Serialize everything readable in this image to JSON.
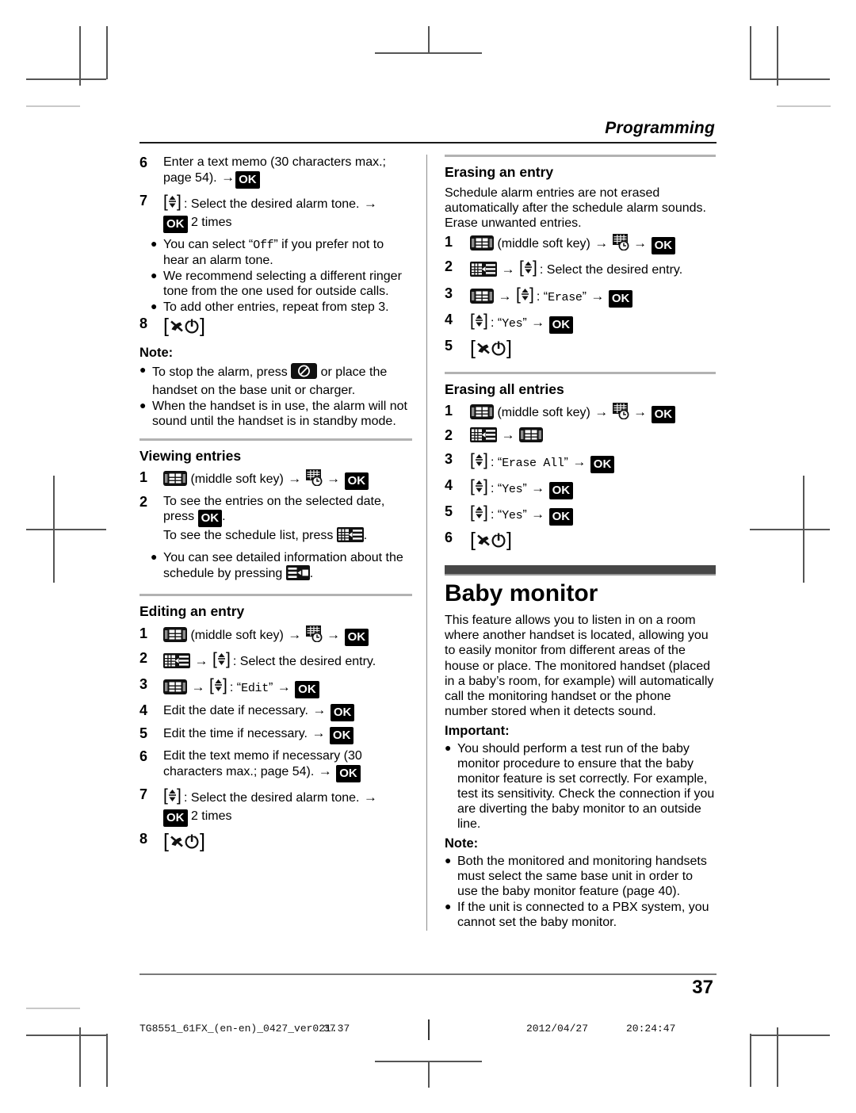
{
  "header": {
    "running_head": "Programming"
  },
  "left_column": {
    "alarm_steps": [
      {
        "n": "6",
        "segments": [
          {
            "t": "text",
            "v": "Enter a text memo (30 characters max.; page 54). "
          },
          {
            "t": "arrow"
          },
          {
            "t": "ok",
            "v": "OK"
          }
        ]
      },
      {
        "n": "7",
        "segments": [
          {
            "t": "navkey"
          },
          {
            "t": "text",
            "v": ": Select the desired alarm tone. "
          },
          {
            "t": "arrow"
          },
          {
            "t": "br"
          },
          {
            "t": "ok",
            "v": "OK"
          },
          {
            "t": "text",
            "v": " 2 times"
          }
        ]
      }
    ],
    "alarm_bullets": [
      {
        "segments": [
          {
            "t": "text",
            "v": "You can select “"
          },
          {
            "t": "mono",
            "v": "Off"
          },
          {
            "t": "text",
            "v": "” if you prefer not to hear an alarm tone."
          }
        ]
      },
      {
        "segments": [
          {
            "t": "text",
            "v": "We recommend selecting a different ringer tone from the one used for outside calls."
          }
        ]
      },
      {
        "segments": [
          {
            "t": "text",
            "v": "To add other entries, repeat from step 3."
          }
        ]
      }
    ],
    "alarm_final_step": {
      "n": "8",
      "segments": [
        {
          "t": "hangup"
        }
      ]
    },
    "note_label": "Note:",
    "note_bullets": [
      {
        "segments": [
          {
            "t": "text",
            "v": "To stop the alarm, press "
          },
          {
            "t": "icon",
            "v": "off-key-icon"
          },
          {
            "t": "text",
            "v": " or place the handset on the base unit or charger."
          }
        ]
      },
      {
        "segments": [
          {
            "t": "text",
            "v": "When the handset is in use, the alarm will not sound until the handset is in standby mode."
          }
        ]
      }
    ],
    "viewing": {
      "title": "Viewing entries",
      "steps": [
        {
          "n": "1",
          "segments": [
            {
              "t": "icon",
              "v": "soft-key-icon"
            },
            {
              "t": "text",
              "v": " (middle soft key) "
            },
            {
              "t": "arrow"
            },
            {
              "t": "text",
              "v": " "
            },
            {
              "t": "icon",
              "v": "schedule-clock-icon"
            },
            {
              "t": "text",
              "v": " "
            },
            {
              "t": "arrow"
            },
            {
              "t": "text",
              "v": " "
            },
            {
              "t": "ok",
              "v": "OK"
            }
          ]
        },
        {
          "n": "2",
          "segments": [
            {
              "t": "text",
              "v": "To see the entries on the selected date, press "
            },
            {
              "t": "ok",
              "v": "OK"
            },
            {
              "t": "text",
              "v": "."
            },
            {
              "t": "br"
            },
            {
              "t": "text",
              "v": "To see the schedule list, press "
            },
            {
              "t": "icon",
              "v": "schedule-list-icon"
            },
            {
              "t": "text",
              "v": "."
            }
          ]
        }
      ],
      "bullets": [
        {
          "segments": [
            {
              "t": "text",
              "v": "You can see detailed information about the schedule by pressing "
            },
            {
              "t": "icon",
              "v": "detail-icon"
            },
            {
              "t": "text",
              "v": "."
            }
          ]
        }
      ]
    },
    "editing": {
      "title": "Editing an entry",
      "steps": [
        {
          "n": "1",
          "segments": [
            {
              "t": "icon",
              "v": "soft-key-icon"
            },
            {
              "t": "text",
              "v": " (middle soft key) "
            },
            {
              "t": "arrow"
            },
            {
              "t": "text",
              "v": " "
            },
            {
              "t": "icon",
              "v": "schedule-clock-icon"
            },
            {
              "t": "text",
              "v": " "
            },
            {
              "t": "arrow"
            },
            {
              "t": "text",
              "v": " "
            },
            {
              "t": "ok",
              "v": "OK"
            }
          ]
        },
        {
          "n": "2",
          "segments": [
            {
              "t": "icon",
              "v": "schedule-list-icon"
            },
            {
              "t": "text",
              "v": " "
            },
            {
              "t": "arrow"
            },
            {
              "t": "text",
              "v": " "
            },
            {
              "t": "navkey"
            },
            {
              "t": "text",
              "v": ": Select the desired entry."
            }
          ]
        },
        {
          "n": "3",
          "segments": [
            {
              "t": "icon",
              "v": "soft-key-icon"
            },
            {
              "t": "text",
              "v": " "
            },
            {
              "t": "arrow"
            },
            {
              "t": "text",
              "v": " "
            },
            {
              "t": "navkey"
            },
            {
              "t": "text",
              "v": ": “"
            },
            {
              "t": "mono",
              "v": "Edit"
            },
            {
              "t": "text",
              "v": "” "
            },
            {
              "t": "arrow"
            },
            {
              "t": "text",
              "v": " "
            },
            {
              "t": "ok",
              "v": "OK"
            }
          ]
        },
        {
          "n": "4",
          "segments": [
            {
              "t": "text",
              "v": "Edit the date if necessary. "
            },
            {
              "t": "arrow"
            },
            {
              "t": "text",
              "v": " "
            },
            {
              "t": "ok",
              "v": "OK"
            }
          ]
        },
        {
          "n": "5",
          "segments": [
            {
              "t": "text",
              "v": "Edit the time if necessary. "
            },
            {
              "t": "arrow"
            },
            {
              "t": "text",
              "v": " "
            },
            {
              "t": "ok",
              "v": "OK"
            }
          ]
        },
        {
          "n": "6",
          "segments": [
            {
              "t": "text",
              "v": "Edit the text memo if necessary (30 characters max.; page 54). "
            },
            {
              "t": "arrow"
            },
            {
              "t": "text",
              "v": " "
            },
            {
              "t": "ok",
              "v": "OK"
            }
          ]
        },
        {
          "n": "7",
          "segments": [
            {
              "t": "navkey"
            },
            {
              "t": "text",
              "v": ": Select the desired alarm tone. "
            },
            {
              "t": "arrow"
            },
            {
              "t": "br"
            },
            {
              "t": "ok",
              "v": "OK"
            },
            {
              "t": "text",
              "v": " 2 times"
            }
          ]
        },
        {
          "n": "8",
          "segments": [
            {
              "t": "hangup"
            }
          ]
        }
      ]
    }
  },
  "right_column": {
    "erasing_entry": {
      "title": "Erasing an entry",
      "intro": "Schedule alarm entries are not erased automatically after the schedule alarm sounds. Erase unwanted entries.",
      "steps": [
        {
          "n": "1",
          "segments": [
            {
              "t": "icon",
              "v": "soft-key-icon"
            },
            {
              "t": "text",
              "v": " (middle soft key) "
            },
            {
              "t": "arrow"
            },
            {
              "t": "text",
              "v": " "
            },
            {
              "t": "icon",
              "v": "schedule-clock-icon"
            },
            {
              "t": "text",
              "v": " "
            },
            {
              "t": "arrow"
            },
            {
              "t": "text",
              "v": " "
            },
            {
              "t": "ok",
              "v": "OK"
            }
          ]
        },
        {
          "n": "2",
          "segments": [
            {
              "t": "icon",
              "v": "schedule-list-icon"
            },
            {
              "t": "text",
              "v": " "
            },
            {
              "t": "arrow"
            },
            {
              "t": "text",
              "v": " "
            },
            {
              "t": "navkey"
            },
            {
              "t": "text",
              "v": ": Select the desired entry."
            }
          ]
        },
        {
          "n": "3",
          "segments": [
            {
              "t": "icon",
              "v": "soft-key-icon"
            },
            {
              "t": "text",
              "v": " "
            },
            {
              "t": "arrow"
            },
            {
              "t": "text",
              "v": " "
            },
            {
              "t": "navkey"
            },
            {
              "t": "text",
              "v": ": “"
            },
            {
              "t": "mono",
              "v": "Erase"
            },
            {
              "t": "text",
              "v": "” "
            },
            {
              "t": "arrow"
            },
            {
              "t": "text",
              "v": " "
            },
            {
              "t": "ok",
              "v": "OK"
            }
          ]
        },
        {
          "n": "4",
          "segments": [
            {
              "t": "navkey"
            },
            {
              "t": "text",
              "v": ": “"
            },
            {
              "t": "mono",
              "v": "Yes"
            },
            {
              "t": "text",
              "v": "” "
            },
            {
              "t": "arrow"
            },
            {
              "t": "text",
              "v": " "
            },
            {
              "t": "ok",
              "v": "OK"
            }
          ]
        },
        {
          "n": "5",
          "segments": [
            {
              "t": "hangup"
            }
          ]
        }
      ]
    },
    "erasing_all": {
      "title": "Erasing all entries",
      "steps": [
        {
          "n": "1",
          "segments": [
            {
              "t": "icon",
              "v": "soft-key-icon"
            },
            {
              "t": "text",
              "v": " (middle soft key) "
            },
            {
              "t": "arrow"
            },
            {
              "t": "text",
              "v": " "
            },
            {
              "t": "icon",
              "v": "schedule-clock-icon"
            },
            {
              "t": "text",
              "v": " "
            },
            {
              "t": "arrow"
            },
            {
              "t": "text",
              "v": " "
            },
            {
              "t": "ok",
              "v": "OK"
            }
          ]
        },
        {
          "n": "2",
          "segments": [
            {
              "t": "icon",
              "v": "schedule-list-icon"
            },
            {
              "t": "text",
              "v": " "
            },
            {
              "t": "arrow"
            },
            {
              "t": "text",
              "v": " "
            },
            {
              "t": "icon",
              "v": "soft-key-icon"
            }
          ]
        },
        {
          "n": "3",
          "segments": [
            {
              "t": "navkey"
            },
            {
              "t": "text",
              "v": ": “"
            },
            {
              "t": "mono",
              "v": "Erase All"
            },
            {
              "t": "text",
              "v": "” "
            },
            {
              "t": "arrow"
            },
            {
              "t": "text",
              "v": " "
            },
            {
              "t": "ok",
              "v": "OK"
            }
          ]
        },
        {
          "n": "4",
          "segments": [
            {
              "t": "navkey"
            },
            {
              "t": "text",
              "v": ": “"
            },
            {
              "t": "mono",
              "v": "Yes"
            },
            {
              "t": "text",
              "v": "” "
            },
            {
              "t": "arrow"
            },
            {
              "t": "text",
              "v": " "
            },
            {
              "t": "ok",
              "v": "OK"
            }
          ]
        },
        {
          "n": "5",
          "segments": [
            {
              "t": "navkey"
            },
            {
              "t": "text",
              "v": ": “"
            },
            {
              "t": "mono",
              "v": "Yes"
            },
            {
              "t": "text",
              "v": "” "
            },
            {
              "t": "arrow"
            },
            {
              "t": "text",
              "v": " "
            },
            {
              "t": "ok",
              "v": "OK"
            }
          ]
        },
        {
          "n": "6",
          "segments": [
            {
              "t": "hangup"
            }
          ]
        }
      ]
    },
    "baby_monitor": {
      "title": "Baby monitor",
      "intro": "This feature allows you to listen in on a room where another handset is located, allowing you to easily monitor from different areas of the house or place. The monitored handset (placed in a baby’s room, for example) will automatically call the monitoring handset or the phone number stored when it detects sound.",
      "important_label": "Important:",
      "important_bullets": [
        {
          "segments": [
            {
              "t": "text",
              "v": "You should perform a test run of the baby monitor procedure to ensure that the baby monitor feature is set correctly. For example, test its sensitivity. Check the connection if you are diverting the baby monitor to an outside line."
            }
          ]
        }
      ],
      "note_label": "Note:",
      "note_bullets": [
        {
          "segments": [
            {
              "t": "text",
              "v": "Both the monitored and monitoring handsets must select the same base unit in order to use the baby monitor feature (page 40)."
            }
          ]
        },
        {
          "segments": [
            {
              "t": "text",
              "v": "If the unit is connected to a PBX system, you cannot set the baby monitor."
            }
          ]
        }
      ]
    }
  },
  "footer": {
    "page_number": "37",
    "build_string": "TG8551_61FX_(en-en)_0427_ver021.37",
    "build_page": "37",
    "date": "2012/04/27",
    "time": "20:24:47"
  }
}
